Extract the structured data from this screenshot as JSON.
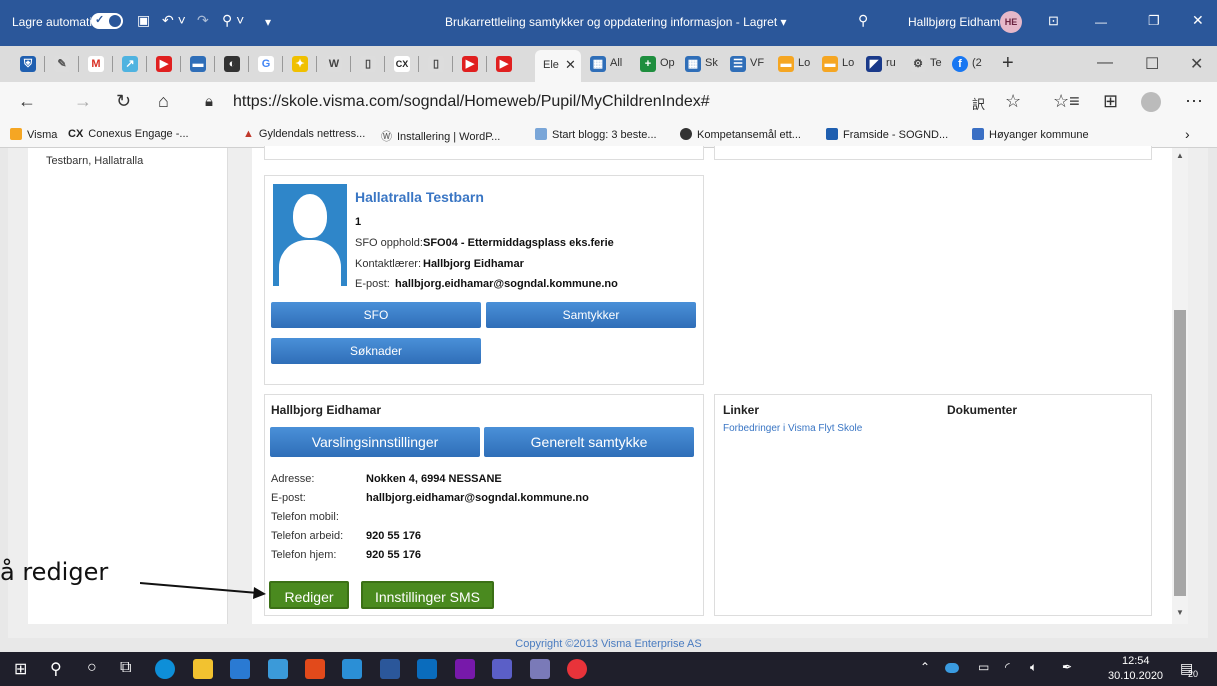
{
  "word": {
    "autosave": "Lagre automatisk",
    "doc_title": "Brukarrettleiing samtykker og oppdatering informasjon - Lagret",
    "user": "Hallbjørg Eidhamar",
    "initials": "HE"
  },
  "browser": {
    "active_tab": "Ele",
    "tab_labels": [
      "All",
      "Op",
      "Sk",
      "VF",
      "Lo",
      "Lo",
      "ru",
      "Te",
      "(2"
    ],
    "url": "https://skole.visma.com/sogndal/Homeweb/Pupil/MyChildrenIndex#"
  },
  "bookmarks": [
    {
      "label": "Visma",
      "color": "#f5a623"
    },
    {
      "label": "Conexus Engage -...",
      "color": "#222222"
    },
    {
      "label": "Gyldendals nettress...",
      "color": "#c0392b"
    },
    {
      "label": "Installering | WordP...",
      "color": "#555555"
    },
    {
      "label": "Start blogg: 3 beste...",
      "color": "#7aa6d8"
    },
    {
      "label": "Kompetansemål ett...",
      "color": "#333333"
    },
    {
      "label": "Framside - SOGND...",
      "color": "#1f5fb0"
    },
    {
      "label": "Høyanger kommune",
      "color": "#3a6fc4"
    }
  ],
  "leftnav": {
    "child": "Testbarn, Hallatralla"
  },
  "student": {
    "name": "Hallatralla Testbarn",
    "grade": "1",
    "sfo_label": "SFO opphold:",
    "sfo_value": "SFO04 - Ettermiddagsplass eks.ferie",
    "teacher_label": "Kontaktlærer:",
    "teacher_value": "Hallbjorg Eidhamar",
    "email_label": "E-post:",
    "email_value": "hallbjorg.eidhamar@sogndal.kommune.no",
    "btn_sfo": "SFO",
    "btn_samtykker": "Samtykker",
    "btn_soknader": "Søknader"
  },
  "parent": {
    "name": "Hallbjorg Eidhamar",
    "btn_varsling": "Varslingsinnstillinger",
    "btn_samtykke": "Generelt samtykke",
    "fields": [
      {
        "label": "Adresse:",
        "value": "Nokken 4, 6994 NESSANE"
      },
      {
        "label": "E-post:",
        "value": "hallbjorg.eidhamar@sogndal.kommune.no"
      },
      {
        "label": "Telefon mobil:",
        "value": ""
      },
      {
        "label": "Telefon arbeid:",
        "value": "920 55 176"
      },
      {
        "label": "Telefon hjem:",
        "value": "920 55 176"
      }
    ],
    "btn_rediger": "Rediger",
    "btn_sms": "Innstillinger SMS"
  },
  "links": {
    "title": "Linker",
    "docs_title": "Dokumenter",
    "items": [
      "Forbedringer i Visma Flyt Skole"
    ]
  },
  "footer": {
    "copyright": "Copyright ©2013 Visma Enterprise AS"
  },
  "annotation": {
    "text": "å rediger"
  },
  "taskbar": {
    "time": "12:54",
    "date": "30.10.2020",
    "notif": "20"
  }
}
